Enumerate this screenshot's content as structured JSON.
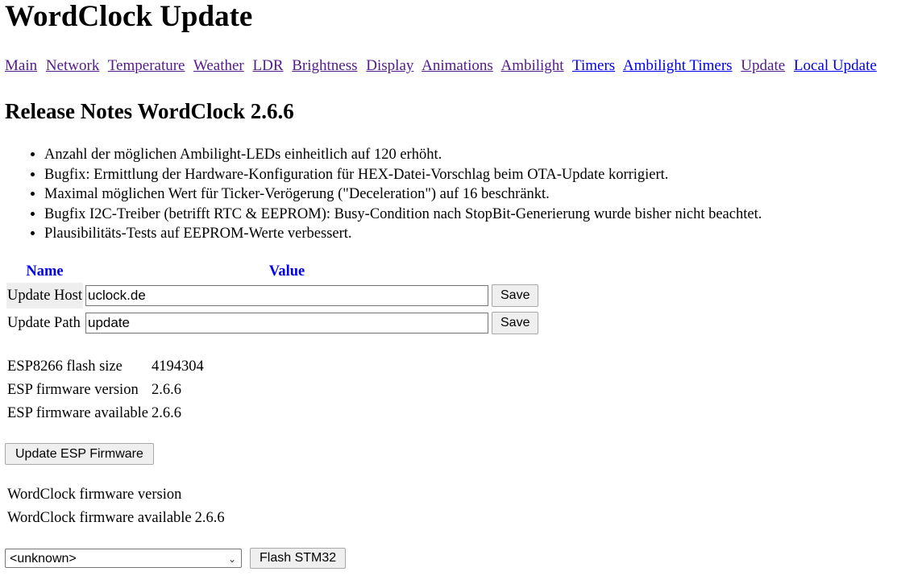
{
  "page_title": "WordClock Update",
  "nav": [
    {
      "label": "Main",
      "visited": true
    },
    {
      "label": "Network",
      "visited": true
    },
    {
      "label": "Temperature",
      "visited": true
    },
    {
      "label": "Weather",
      "visited": true
    },
    {
      "label": "LDR",
      "visited": true
    },
    {
      "label": "Brightness",
      "visited": true
    },
    {
      "label": "Display",
      "visited": true
    },
    {
      "label": "Animations",
      "visited": true
    },
    {
      "label": "Ambilight",
      "visited": true
    },
    {
      "label": "Timers",
      "visited": false
    },
    {
      "label": "Ambilight Timers",
      "visited": false
    },
    {
      "label": "Update",
      "visited": true
    },
    {
      "label": "Local Update",
      "visited": false
    }
  ],
  "release_notes": {
    "heading": "Release Notes WordClock 2.6.6",
    "items": [
      "Anzahl der möglichen Ambilight-LEDs einheitlich auf 120 erhöht.",
      "Bugfix: Ermittlung der Hardware-Konfiguration für HEX-Datei-Vorschlag beim OTA-Update korrigiert.",
      "Maximal möglichen Wert für Ticker-Verögerung (\"Deceleration\") auf 16 beschränkt.",
      "Bugfix I2C-Treiber (betrifft RTC & EEPROM): Busy-Condition nach StopBit-Generierung wurde bisher nicht beachtet.",
      "Plausibilitäts-Tests auf EEPROM-Werte verbessert."
    ]
  },
  "settings_table": {
    "header_name": "Name",
    "header_value": "Value",
    "rows": [
      {
        "name": "Update Host",
        "value": "uclock.de",
        "button": "Save"
      },
      {
        "name": "Update Path",
        "value": "update",
        "button": "Save"
      }
    ]
  },
  "esp_info": [
    {
      "label": "ESP8266 flash size",
      "value": "4194304"
    },
    {
      "label": "ESP firmware version",
      "value": "2.6.6"
    },
    {
      "label": "ESP firmware available",
      "value": "2.6.6"
    }
  ],
  "esp_update_button": "Update ESP Firmware",
  "wordclock_info": [
    {
      "label": "WordClock firmware version",
      "value": ""
    },
    {
      "label": "WordClock firmware available",
      "value": "2.6.6"
    }
  ],
  "flash": {
    "selected": "<unknown>",
    "button": "Flash STM32"
  },
  "colors": {
    "link_visited": "#551a8b",
    "link_unvisited": "#0000ee",
    "table_header": "#0000ee",
    "row_shade": "#eeeeee"
  },
  "icons": {
    "select_arrow": "chevron-down-icon"
  }
}
